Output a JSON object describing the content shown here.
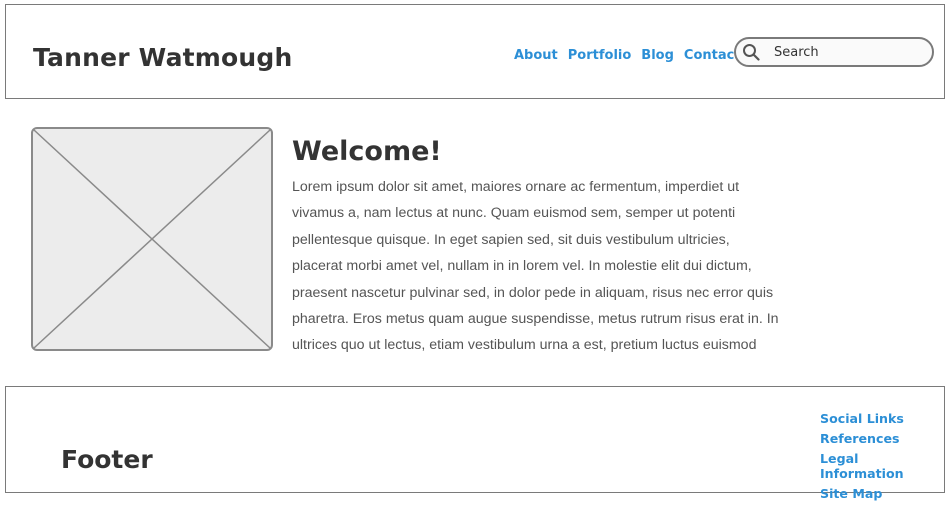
{
  "header": {
    "title": "Tanner Watmough",
    "nav": [
      "About",
      "Portfolio",
      "Blog",
      "Contact"
    ],
    "search_placeholder": "Search"
  },
  "main": {
    "heading": "Welcome!",
    "body_lines": [
      "Lorem ipsum dolor sit amet, maiores ornare ac fermentum, imperdiet ut",
      "vivamus a, nam lectus at nunc. Quam euismod sem, semper ut potenti",
      "pellentesque quisque. In eget sapien sed, sit duis vestibulum ultricies,",
      "placerat morbi amet vel, nullam in in lorem vel. In molestie elit dui dictum,",
      "praesent nascetur pulvinar sed, in dolor pede in aliquam, risus nec error quis",
      "pharetra. Eros metus quam augue suspendisse, metus rutrum risus erat in.  In",
      "ultrices quo ut lectus, etiam vestibulum urna a est, pretium luctus euismod"
    ]
  },
  "footer": {
    "title": "Footer",
    "links": [
      "Social Links",
      "References",
      "Legal Information",
      "Site Map"
    ]
  },
  "colors": {
    "link": "#2c8fd6",
    "border": "#7a7a7a",
    "placeholder_fill": "#ececec"
  }
}
